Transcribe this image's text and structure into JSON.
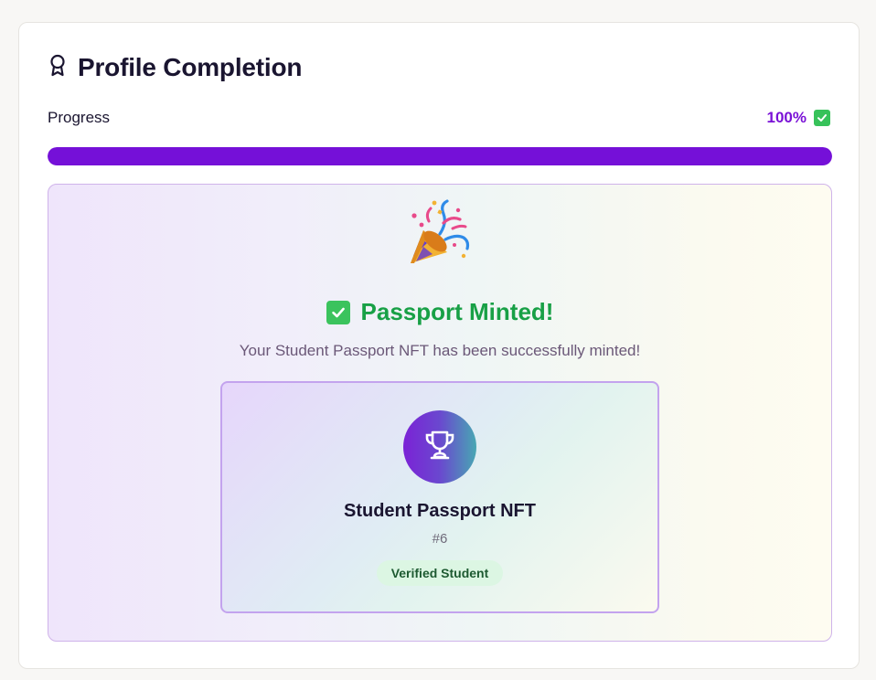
{
  "header": {
    "title": "Profile Completion",
    "icon": "award-icon"
  },
  "progress": {
    "label": "Progress",
    "percent_text": "100%",
    "value": 1.0,
    "fill_color": "#7510d8",
    "status_icon": "check-box-icon"
  },
  "success": {
    "icon": "party-popper-icon",
    "title": "Passport Minted!",
    "title_icon": "check-box-icon",
    "subtitle": "Your Student Passport NFT has been successfully minted!",
    "title_color": "#18a046"
  },
  "nft": {
    "icon": "trophy-icon",
    "name": "Student Passport NFT",
    "id": "#6",
    "badge": "Verified Student"
  }
}
